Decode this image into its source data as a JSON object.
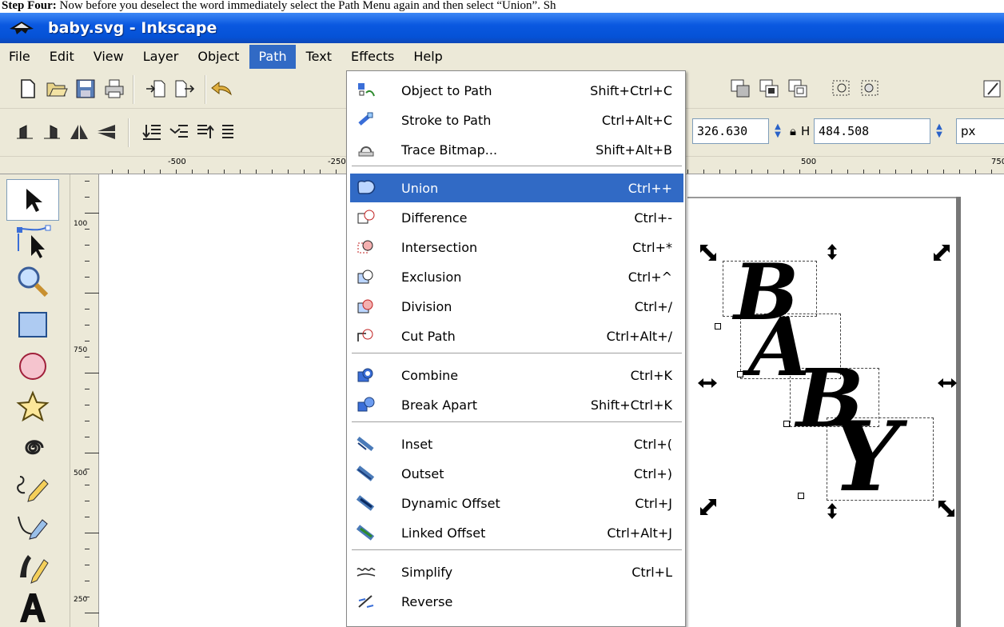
{
  "caption": {
    "step": "Step Four:",
    "text": "Now before you deselect the word immediately select the Path Menu again and then select “Union”. Sh"
  },
  "window": {
    "title": "baby.svg - Inkscape"
  },
  "menubar": [
    "File",
    "Edit",
    "View",
    "Layer",
    "Object",
    "Path",
    "Text",
    "Effects",
    "Help"
  ],
  "toolbar2": {
    "w_value": "326.630",
    "h_label": "H",
    "h_value": "484.508",
    "unit": "px"
  },
  "ruler": {
    "labels": [
      "-500",
      "-250",
      "500",
      "750"
    ]
  },
  "vruler": {
    "labels": [
      "100",
      "750",
      "500",
      "250"
    ]
  },
  "path_menu": {
    "items": [
      {
        "label": "Object to Path",
        "shortcut": "Shift+Ctrl+C",
        "icon": "object-to-path-icon"
      },
      {
        "label": "Stroke to Path",
        "shortcut": "Ctrl+Alt+C",
        "icon": "stroke-to-path-icon"
      },
      {
        "label": "Trace Bitmap...",
        "shortcut": "Shift+Alt+B",
        "icon": "trace-bitmap-icon"
      },
      {
        "label": "Union",
        "shortcut": "Ctrl++",
        "icon": "union-icon",
        "highlighted": true
      },
      {
        "label": "Difference",
        "shortcut": "Ctrl+-",
        "icon": "difference-icon"
      },
      {
        "label": "Intersection",
        "shortcut": "Ctrl+*",
        "icon": "intersection-icon"
      },
      {
        "label": "Exclusion",
        "shortcut": "Ctrl+^",
        "icon": "exclusion-icon"
      },
      {
        "label": "Division",
        "shortcut": "Ctrl+/",
        "icon": "division-icon"
      },
      {
        "label": "Cut Path",
        "shortcut": "Ctrl+Alt+/",
        "icon": "cut-path-icon"
      },
      {
        "label": "Combine",
        "shortcut": "Ctrl+K",
        "icon": "combine-icon"
      },
      {
        "label": "Break Apart",
        "shortcut": "Shift+Ctrl+K",
        "icon": "break-apart-icon"
      },
      {
        "label": "Inset",
        "shortcut": "Ctrl+(",
        "icon": "inset-icon"
      },
      {
        "label": "Outset",
        "shortcut": "Ctrl+)",
        "icon": "outset-icon"
      },
      {
        "label": "Dynamic Offset",
        "shortcut": "Ctrl+J",
        "icon": "dynamic-offset-icon"
      },
      {
        "label": "Linked Offset",
        "shortcut": "Ctrl+Alt+J",
        "icon": "linked-offset-icon"
      },
      {
        "label": "Simplify",
        "shortcut": "Ctrl+L",
        "icon": "simplify-icon"
      },
      {
        "label": "Reverse",
        "shortcut": "",
        "icon": "reverse-icon"
      }
    ]
  },
  "canvas": {
    "letters": [
      "B",
      "A",
      "B",
      "Y"
    ]
  },
  "colors": {
    "highlight": "#316ac5",
    "titlebar": "#0a58e0",
    "chrome": "#ece9d8"
  }
}
